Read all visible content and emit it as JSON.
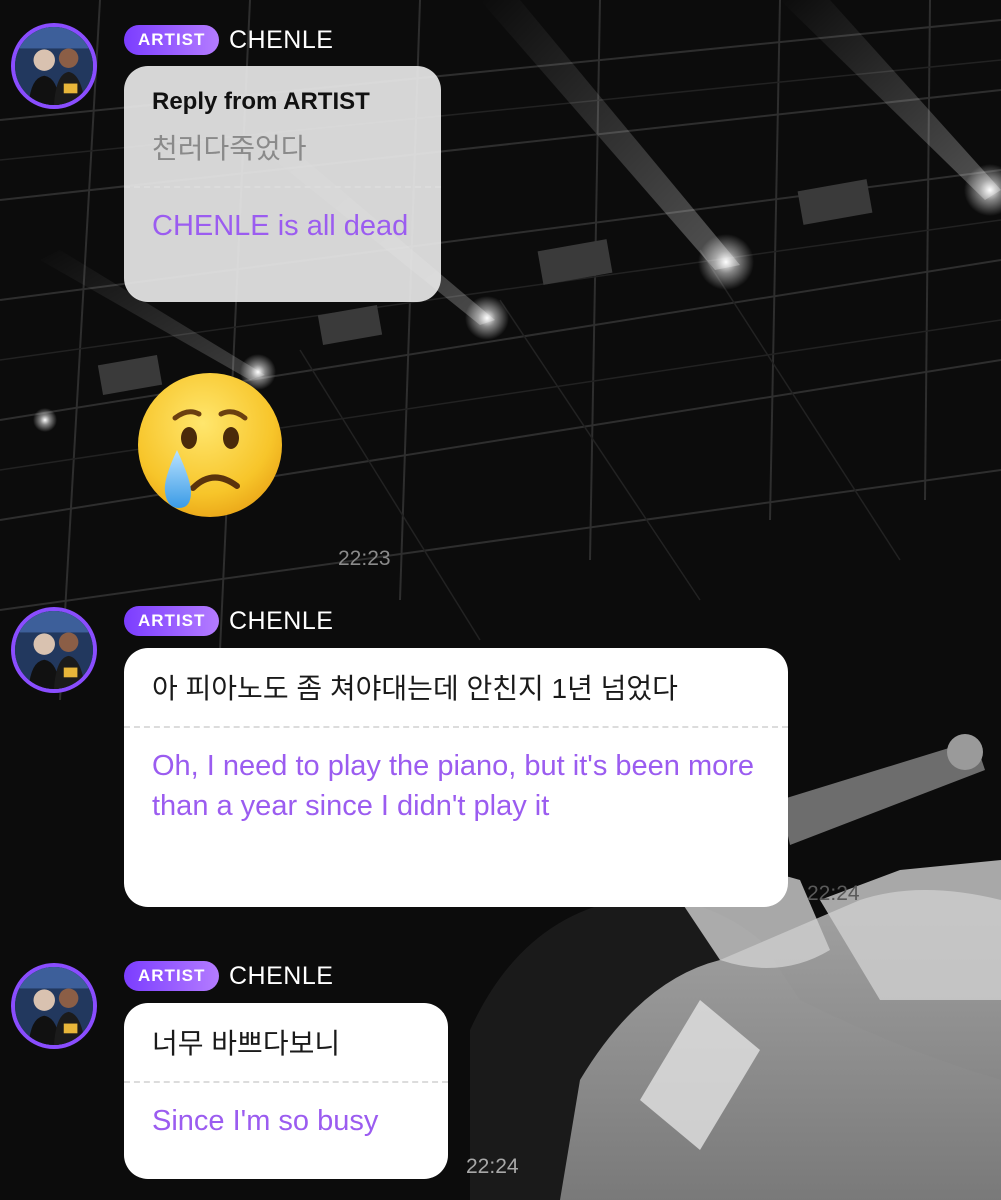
{
  "messages": [
    {
      "badge": "ARTIST",
      "sender": "CHENLE",
      "reply_header": "Reply from ARTIST",
      "original": "천러다죽었다",
      "translation": "CHENLE is all dead",
      "emoji": "crying-face",
      "time": "22:23"
    },
    {
      "badge": "ARTIST",
      "sender": "CHENLE",
      "original": "아 피아노도 좀 쳐야대는데 안친지 1년 넘었다",
      "translation": "Oh, I need to play the piano, but it's been more than a year since I didn't play it",
      "time": "22:24"
    },
    {
      "badge": "ARTIST",
      "sender": "CHENLE",
      "original": "너무 바쁘다보니",
      "translation": "Since I'm so busy",
      "time": "22:24"
    }
  ],
  "colors": {
    "accent": "#8a4dff",
    "translation_text": "#9b5cf0",
    "badge_gradient_start": "#7b3dff",
    "badge_gradient_end": "#b47cff"
  }
}
